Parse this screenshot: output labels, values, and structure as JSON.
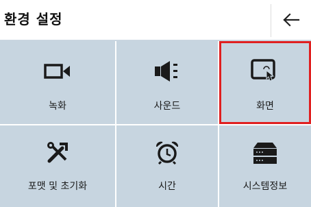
{
  "header": {
    "title": "환경 설정",
    "back_icon": "arrow-left-icon"
  },
  "tiles": [
    {
      "label": "녹화",
      "icon": "video-camera-icon",
      "selected": false
    },
    {
      "label": "사운드",
      "icon": "speaker-icon",
      "selected": false
    },
    {
      "label": "화면",
      "icon": "screen-touch-icon",
      "selected": true
    },
    {
      "label": "포맷 및 초기화",
      "icon": "tools-icon",
      "selected": false
    },
    {
      "label": "시간",
      "icon": "alarm-clock-icon",
      "selected": false
    },
    {
      "label": "시스템정보",
      "icon": "server-icon",
      "selected": false
    }
  ],
  "colors": {
    "tile_bg": "#c7d5e0",
    "selected_border": "#e02020",
    "icon": "#1a1a1a"
  }
}
